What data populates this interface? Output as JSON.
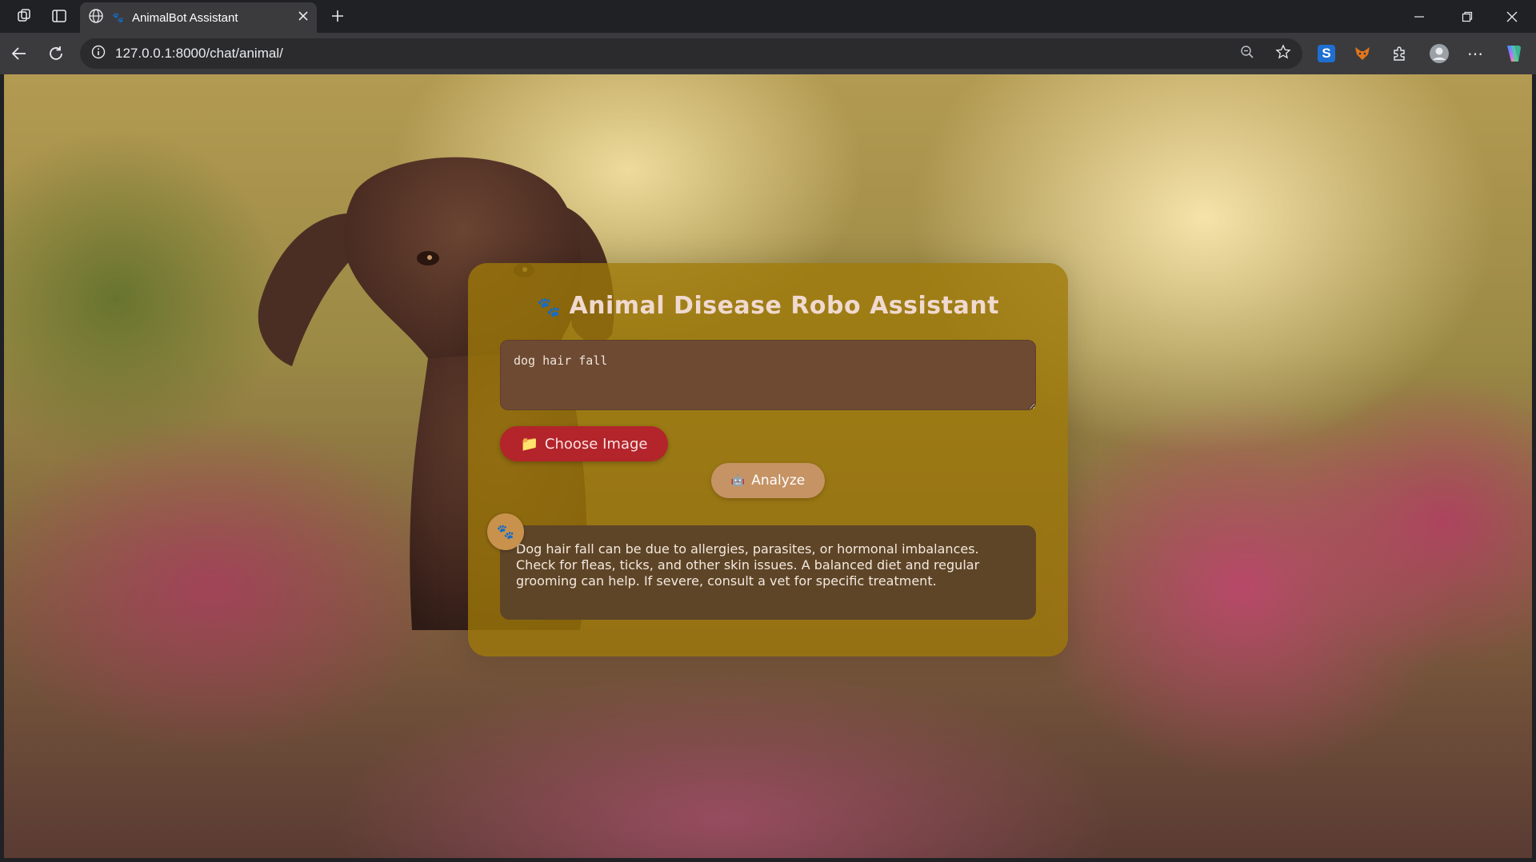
{
  "browser": {
    "tab_title": "AnimalBot Assistant",
    "tab_favicon": "paw-icon",
    "url": "127.0.0.1:8000/chat/animal/",
    "new_tab_label": "+"
  },
  "page": {
    "title": "Animal Disease Robo Assistant",
    "title_icon": "🐾",
    "query_value": "dog hair fall",
    "choose_image_icon": "📁",
    "choose_image_label": "Choose Image",
    "analyze_icon": "🤖",
    "analyze_label": "Analyze",
    "avatar_icon": "🐾",
    "response_text": "Dog hair fall can be due to allergies, parasites, or hormonal imbalances. Check for fleas, ticks, and other skin issues. A balanced diet and regular grooming can help. If severe, consult a vet for specific treatment."
  },
  "colors": {
    "card": "#9e7808",
    "choose_button": "#b3242b",
    "analyze_button": "#c69364",
    "response_bubble": "#5e4527",
    "query_box": "#6e4a33"
  }
}
